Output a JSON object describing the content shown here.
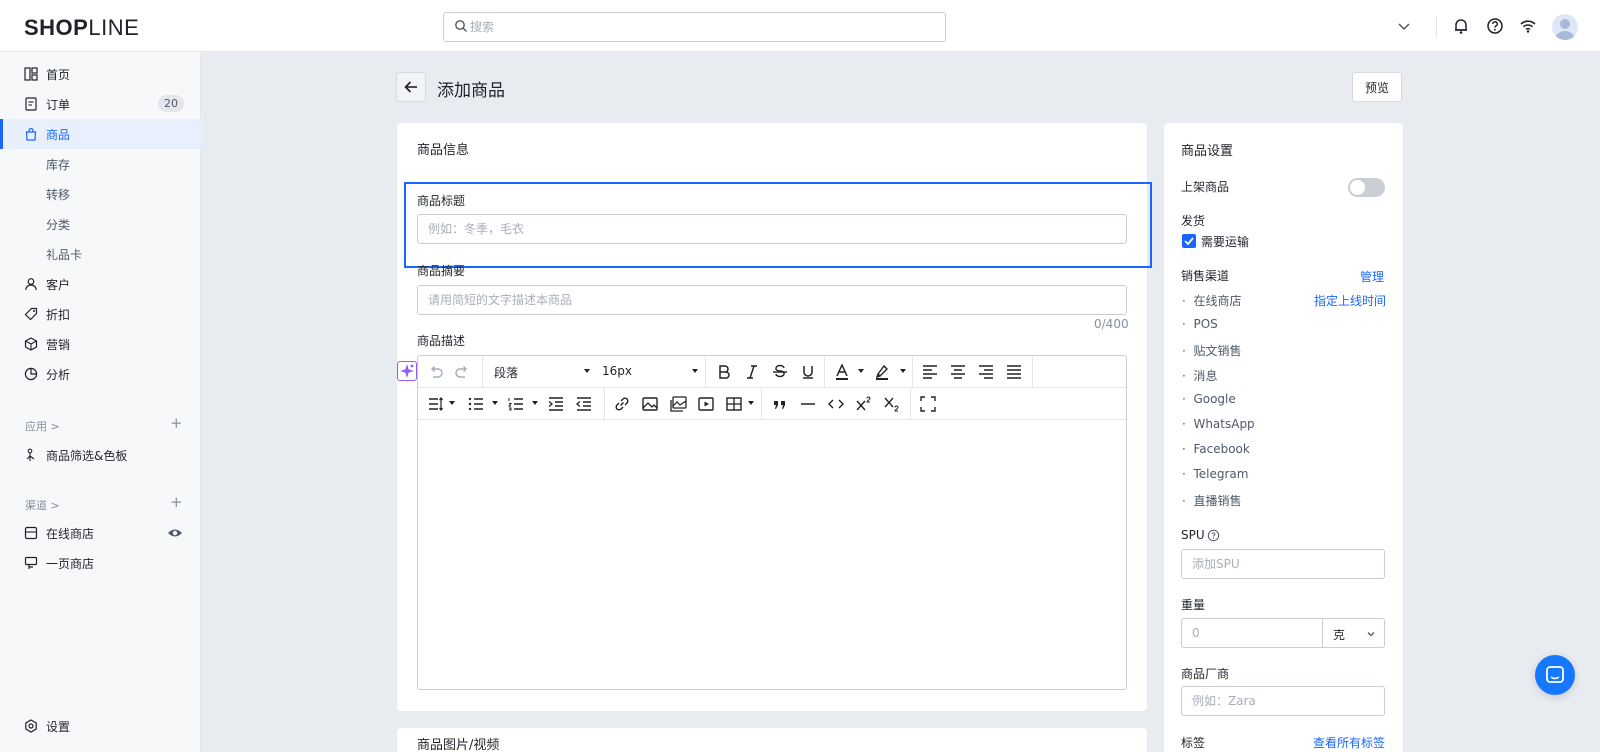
{
  "brand": {
    "logo_bold": "SHOP",
    "logo_light": "LINE"
  },
  "search": {
    "placeholder": "搜索"
  },
  "sidebar": {
    "items": [
      {
        "label": "首页"
      },
      {
        "label": "订单",
        "badge": "20"
      },
      {
        "label": "商品",
        "active": true
      },
      {
        "label": "库存"
      },
      {
        "label": "转移"
      },
      {
        "label": "分类"
      },
      {
        "label": "礼品卡"
      },
      {
        "label": "客户"
      },
      {
        "label": "折扣"
      },
      {
        "label": "营销"
      },
      {
        "label": "分析"
      }
    ],
    "apps_section": {
      "label": "应用 >",
      "plus": "+"
    },
    "apps": [
      {
        "label": "商品筛选&色板"
      }
    ],
    "channels_section": {
      "label": "渠道 >",
      "plus": "+"
    },
    "channels": [
      {
        "label": "在线商店"
      },
      {
        "label": "一页商店"
      }
    ],
    "settings": {
      "label": "设置"
    }
  },
  "page": {
    "title": "添加商品",
    "preview_label": "预览"
  },
  "product_info": {
    "card_title": "商品信息",
    "title_label": "商品标题",
    "title_placeholder": "例如：冬季，毛衣",
    "summary_label": "商品摘要",
    "summary_placeholder": "请用简短的文字描述本商品",
    "summary_counter": "0/400",
    "description_label": "商品描述",
    "editor": {
      "paragraph": "段落",
      "font_size": "16px"
    },
    "next_card_title": "商品图片/视频"
  },
  "settings_panel": {
    "title": "商品设置",
    "publish_label": "上架商品",
    "publish_on": false,
    "shipping_label": "发货",
    "shipping_checkbox": "需要运输",
    "shipping_checked": true,
    "channels_label": "销售渠道",
    "channels_manage": "管理",
    "schedule_link": "指定上线时间",
    "channels": [
      "在线商店",
      "POS",
      "贴文销售",
      "消息",
      "Google",
      "WhatsApp",
      "Facebook",
      "Telegram",
      "直播销售"
    ],
    "spu_label": "SPU",
    "spu_placeholder": "添加SPU",
    "weight_label": "重量",
    "weight_placeholder": "0",
    "weight_unit": "克",
    "vendor_label": "商品厂商",
    "vendor_placeholder": "例如：Zara",
    "tags_label": "标签",
    "tags_link": "查看所有标签"
  },
  "colors": {
    "accent": "#1966ff",
    "ai": "#8f5cf7",
    "chat": "#1677ff"
  }
}
